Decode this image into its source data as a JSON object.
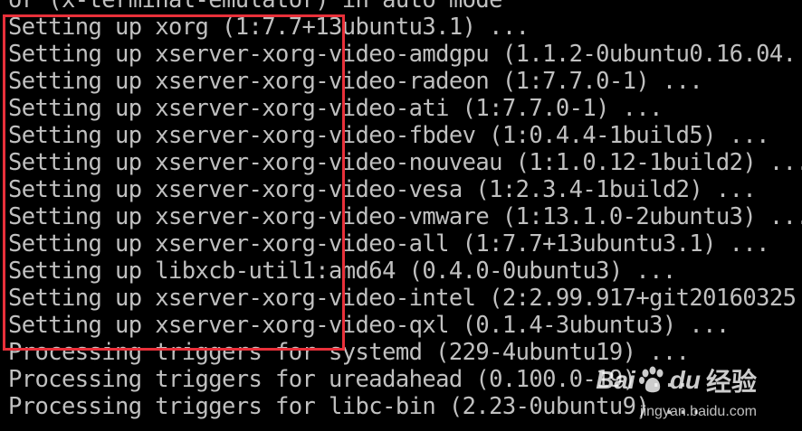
{
  "terminal": {
    "lines": [
      "or (x-terminal-emulator) in auto mode",
      "Setting up xorg (1:7.7+13ubuntu3.1) ...",
      "Setting up xserver-xorg-video-amdgpu (1.1.2-0ubuntu0.16.04.",
      "Setting up xserver-xorg-video-radeon (1:7.7.0-1) ...",
      "Setting up xserver-xorg-video-ati (1:7.7.0-1) ...",
      "Setting up xserver-xorg-video-fbdev (1:0.4.4-1build5) ...",
      "Setting up xserver-xorg-video-nouveau (1:1.0.12-1build2) ...",
      "Setting up xserver-xorg-video-vesa (1:2.3.4-1build2) ...",
      "Setting up xserver-xorg-video-vmware (1:13.1.0-2ubuntu3) ...",
      "Setting up xserver-xorg-video-all (1:7.7+13ubuntu3.1) ...",
      "Setting up libxcb-util1:amd64 (0.4.0-0ubuntu3) ...",
      "Setting up xserver-xorg-video-intel (2:2.99.917+git20160325",
      "Setting up xserver-xorg-video-qxl (0.1.4-3ubuntu3) ...",
      "Processing triggers for systemd (229-4ubuntu19) ...",
      "Processing triggers for ureadahead (0.100.0-19) ...",
      "Processing triggers for libc-bin (2.23-0ubuntu9) ..."
    ]
  },
  "watermark": {
    "bai": "Bai",
    "du": "du",
    "cn": "经验",
    "url": "jingyan.baidu.com"
  },
  "colors": {
    "background": "#000000",
    "text": "#c0c0c0",
    "highlight": "#e8303a"
  }
}
